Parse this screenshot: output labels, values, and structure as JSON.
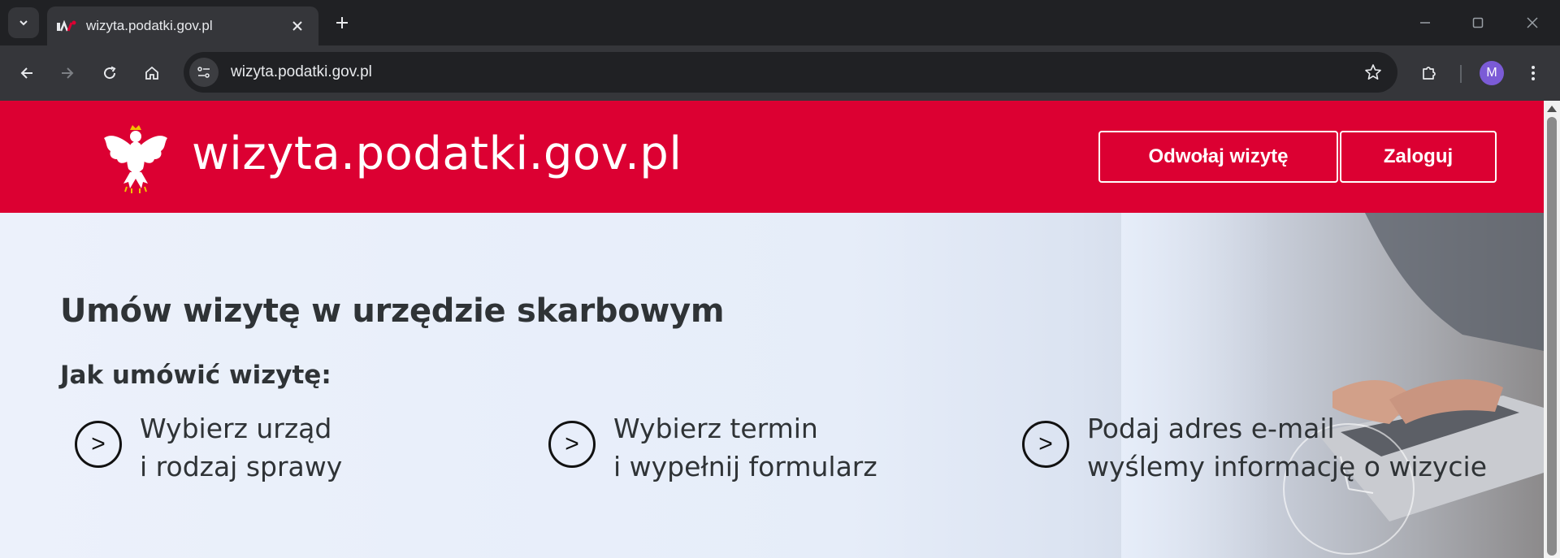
{
  "browser": {
    "tab_title": "wizyta.podatki.gov.pl",
    "url": "wizyta.podatki.gov.pl",
    "profile_initial": "M"
  },
  "header": {
    "site_name": "wizyta.podatki.gov.pl",
    "cancel_visit_label": "Odwołaj wizytę",
    "login_label": "Zaloguj"
  },
  "hero": {
    "title": "Umów wizytę w urzędzie skarbowym",
    "subtitle": "Jak umówić wizytę:",
    "steps": [
      {
        "icon": ">",
        "line1": "Wybierz urząd",
        "line2": "i rodzaj sprawy"
      },
      {
        "icon": ">",
        "line1": "Wybierz termin",
        "line2": "i wypełnij formularz"
      },
      {
        "icon": ">",
        "line1": "Podaj adres e-mail",
        "line2": "wyślemy informację o wizycie"
      }
    ]
  },
  "colors": {
    "brand_red": "#dc0032",
    "hero_bg": "#e9effa",
    "chrome_dark": "#202124",
    "chrome_toolbar": "#35363a"
  }
}
